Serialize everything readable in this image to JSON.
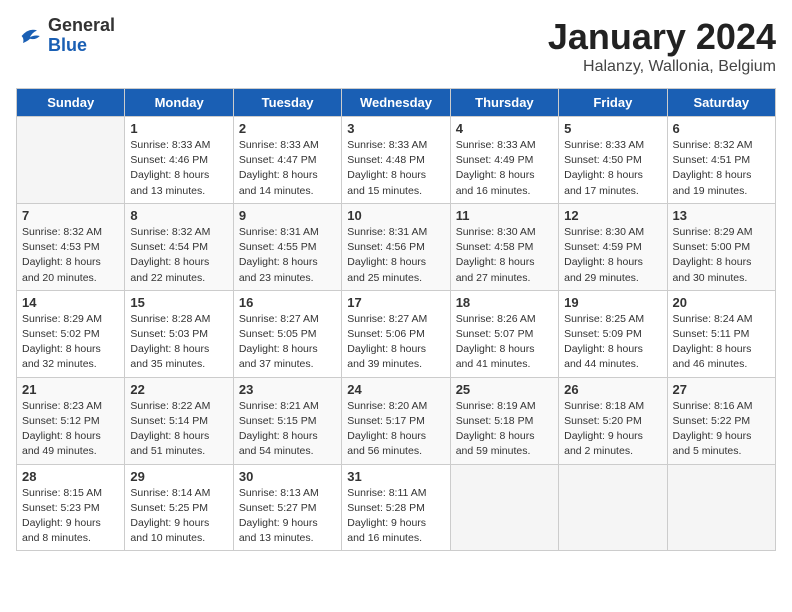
{
  "header": {
    "logo_general": "General",
    "logo_blue": "Blue",
    "month_title": "January 2024",
    "location": "Halanzy, Wallonia, Belgium"
  },
  "weekdays": [
    "Sunday",
    "Monday",
    "Tuesday",
    "Wednesday",
    "Thursday",
    "Friday",
    "Saturday"
  ],
  "weeks": [
    [
      {
        "day": "",
        "empty": true
      },
      {
        "day": "1",
        "sunrise": "8:33 AM",
        "sunset": "4:46 PM",
        "daylight": "8 hours and 13 minutes."
      },
      {
        "day": "2",
        "sunrise": "8:33 AM",
        "sunset": "4:47 PM",
        "daylight": "8 hours and 14 minutes."
      },
      {
        "day": "3",
        "sunrise": "8:33 AM",
        "sunset": "4:48 PM",
        "daylight": "8 hours and 15 minutes."
      },
      {
        "day": "4",
        "sunrise": "8:33 AM",
        "sunset": "4:49 PM",
        "daylight": "8 hours and 16 minutes."
      },
      {
        "day": "5",
        "sunrise": "8:33 AM",
        "sunset": "4:50 PM",
        "daylight": "8 hours and 17 minutes."
      },
      {
        "day": "6",
        "sunrise": "8:32 AM",
        "sunset": "4:51 PM",
        "daylight": "8 hours and 19 minutes."
      }
    ],
    [
      {
        "day": "7",
        "sunrise": "8:32 AM",
        "sunset": "4:53 PM",
        "daylight": "8 hours and 20 minutes."
      },
      {
        "day": "8",
        "sunrise": "8:32 AM",
        "sunset": "4:54 PM",
        "daylight": "8 hours and 22 minutes."
      },
      {
        "day": "9",
        "sunrise": "8:31 AM",
        "sunset": "4:55 PM",
        "daylight": "8 hours and 23 minutes."
      },
      {
        "day": "10",
        "sunrise": "8:31 AM",
        "sunset": "4:56 PM",
        "daylight": "8 hours and 25 minutes."
      },
      {
        "day": "11",
        "sunrise": "8:30 AM",
        "sunset": "4:58 PM",
        "daylight": "8 hours and 27 minutes."
      },
      {
        "day": "12",
        "sunrise": "8:30 AM",
        "sunset": "4:59 PM",
        "daylight": "8 hours and 29 minutes."
      },
      {
        "day": "13",
        "sunrise": "8:29 AM",
        "sunset": "5:00 PM",
        "daylight": "8 hours and 30 minutes."
      }
    ],
    [
      {
        "day": "14",
        "sunrise": "8:29 AM",
        "sunset": "5:02 PM",
        "daylight": "8 hours and 32 minutes."
      },
      {
        "day": "15",
        "sunrise": "8:28 AM",
        "sunset": "5:03 PM",
        "daylight": "8 hours and 35 minutes."
      },
      {
        "day": "16",
        "sunrise": "8:27 AM",
        "sunset": "5:05 PM",
        "daylight": "8 hours and 37 minutes."
      },
      {
        "day": "17",
        "sunrise": "8:27 AM",
        "sunset": "5:06 PM",
        "daylight": "8 hours and 39 minutes."
      },
      {
        "day": "18",
        "sunrise": "8:26 AM",
        "sunset": "5:07 PM",
        "daylight": "8 hours and 41 minutes."
      },
      {
        "day": "19",
        "sunrise": "8:25 AM",
        "sunset": "5:09 PM",
        "daylight": "8 hours and 44 minutes."
      },
      {
        "day": "20",
        "sunrise": "8:24 AM",
        "sunset": "5:11 PM",
        "daylight": "8 hours and 46 minutes."
      }
    ],
    [
      {
        "day": "21",
        "sunrise": "8:23 AM",
        "sunset": "5:12 PM",
        "daylight": "8 hours and 49 minutes."
      },
      {
        "day": "22",
        "sunrise": "8:22 AM",
        "sunset": "5:14 PM",
        "daylight": "8 hours and 51 minutes."
      },
      {
        "day": "23",
        "sunrise": "8:21 AM",
        "sunset": "5:15 PM",
        "daylight": "8 hours and 54 minutes."
      },
      {
        "day": "24",
        "sunrise": "8:20 AM",
        "sunset": "5:17 PM",
        "daylight": "8 hours and 56 minutes."
      },
      {
        "day": "25",
        "sunrise": "8:19 AM",
        "sunset": "5:18 PM",
        "daylight": "8 hours and 59 minutes."
      },
      {
        "day": "26",
        "sunrise": "8:18 AM",
        "sunset": "5:20 PM",
        "daylight": "9 hours and 2 minutes."
      },
      {
        "day": "27",
        "sunrise": "8:16 AM",
        "sunset": "5:22 PM",
        "daylight": "9 hours and 5 minutes."
      }
    ],
    [
      {
        "day": "28",
        "sunrise": "8:15 AM",
        "sunset": "5:23 PM",
        "daylight": "9 hours and 8 minutes."
      },
      {
        "day": "29",
        "sunrise": "8:14 AM",
        "sunset": "5:25 PM",
        "daylight": "9 hours and 10 minutes."
      },
      {
        "day": "30",
        "sunrise": "8:13 AM",
        "sunset": "5:27 PM",
        "daylight": "9 hours and 13 minutes."
      },
      {
        "day": "31",
        "sunrise": "8:11 AM",
        "sunset": "5:28 PM",
        "daylight": "9 hours and 16 minutes."
      },
      {
        "day": "",
        "empty": true
      },
      {
        "day": "",
        "empty": true
      },
      {
        "day": "",
        "empty": true
      }
    ]
  ],
  "labels": {
    "sunrise": "Sunrise:",
    "sunset": "Sunset:",
    "daylight": "Daylight:"
  }
}
